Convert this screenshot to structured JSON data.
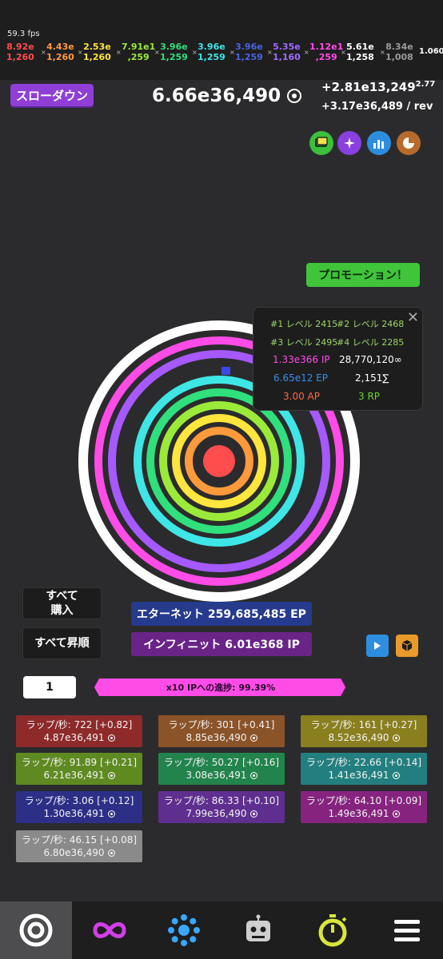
{
  "top": {
    "fps": "59.3 fps",
    "multipliers": [
      {
        "top": "8.92e",
        "bottom": "1,260",
        "color": "#ff4c4c"
      },
      {
        "top": "4.43e",
        "bottom": "1,260",
        "color": "#ff9a3c"
      },
      {
        "top": "2.53e",
        "bottom": "1,260",
        "color": "#ffe53c"
      },
      {
        "top": "7.91e1",
        "bottom": ",259",
        "color": "#9bea3a"
      },
      {
        "top": "3.96e",
        "bottom": "1,259",
        "color": "#2fe07c"
      },
      {
        "top": "3.96e",
        "bottom": "1,259",
        "color": "#3ee6e6"
      },
      {
        "top": "3.96e",
        "bottom": "1,259",
        "color": "#4a62e6"
      },
      {
        "top": "5.35e",
        "bottom": "1,160",
        "color": "#a06bff"
      },
      {
        "top": "1.12e1",
        "bottom": ",259",
        "color": "#ff4ce6"
      },
      {
        "top": "5.61e",
        "bottom": "1,258",
        "color": "#ffffff"
      },
      {
        "top": "8.34e",
        "bottom": "1,008",
        "color": "#9a9a9a"
      }
    ],
    "sep": "×",
    "last": "1.060"
  },
  "header": {
    "slowdown": "スローダウン",
    "main_value": "6.66e36,490",
    "rate_per_sec": "+2.81e13,249",
    "rate_exp": "2.77",
    "rate_per_rev": "+3.17e36,489 / rev"
  },
  "icons": {
    "colors": [
      "#3cbf3c",
      "#8a3fe0",
      "#2d8ee0",
      "#b86a2a"
    ]
  },
  "promotion": "プロモーション！",
  "popup": {
    "lv1": "#1 レベル 2415",
    "lv2": "#2 レベル 2468",
    "lv3": "#3 レベル 2495",
    "lv4": "#4 レベル 2285",
    "ip": "1.33e366 IP",
    "inf": "28,770,120∞",
    "ep": "6.65e12 EP",
    "sum": "2,151∑",
    "ap": "3.00 AP",
    "rp": "3 RP",
    "close": "✕"
  },
  "buttons": {
    "buy_all_line1": "すべて",
    "buy_all_line2": "購入",
    "ascend_all": "すべて昇順",
    "eternet": "エターネット 259,685,485 EP",
    "infinity": "インフィニット 6.01e368 IP"
  },
  "qty": "1",
  "progress": {
    "label": "x10 IPへの進捗: 99.39%",
    "fraction": 0.9939
  },
  "cards": [
    {
      "rate": "ラップ/秒: 722 [+0.82]",
      "cost": "4.87e36,491",
      "color": "#8e2a2a"
    },
    {
      "rate": "ラップ/秒: 301 [+0.41]",
      "cost": "8.85e36,490",
      "color": "#8b5328"
    },
    {
      "rate": "ラップ/秒: 161 [+0.27]",
      "cost": "8.52e36,490",
      "color": "#8a7f1f"
    },
    {
      "rate": "ラップ/秒: 91.89 [+0.21]",
      "cost": "6.21e36,491",
      "color": "#5f8a22"
    },
    {
      "rate": "ラップ/秒: 50.27 [+0.16]",
      "cost": "3.08e36,491",
      "color": "#23834d"
    },
    {
      "rate": "ラップ/秒: 22.66 [+0.14]",
      "cost": "1.41e36,491",
      "color": "#237f7f"
    },
    {
      "rate": "ラップ/秒: 3.06 [+0.12]",
      "cost": "1.30e36,491",
      "color": "#2d2f86"
    },
    {
      "rate": "ラップ/秒: 86.33 [+0.10]",
      "cost": "7.99e36,490",
      "color": "#5f2f8f"
    },
    {
      "rate": "ラップ/秒: 64.10 [+0.09]",
      "cost": "1.49e36,491",
      "color": "#86237f"
    },
    {
      "rate": "ラップ/秒: 46.15 [+0.08]",
      "cost": "6.80e36,490",
      "color": "#8a8a8a"
    }
  ],
  "nav": [
    "target-icon",
    "infinity-icon",
    "gear-dots-icon",
    "robot-icon",
    "stopwatch-icon",
    "menu-icon"
  ]
}
